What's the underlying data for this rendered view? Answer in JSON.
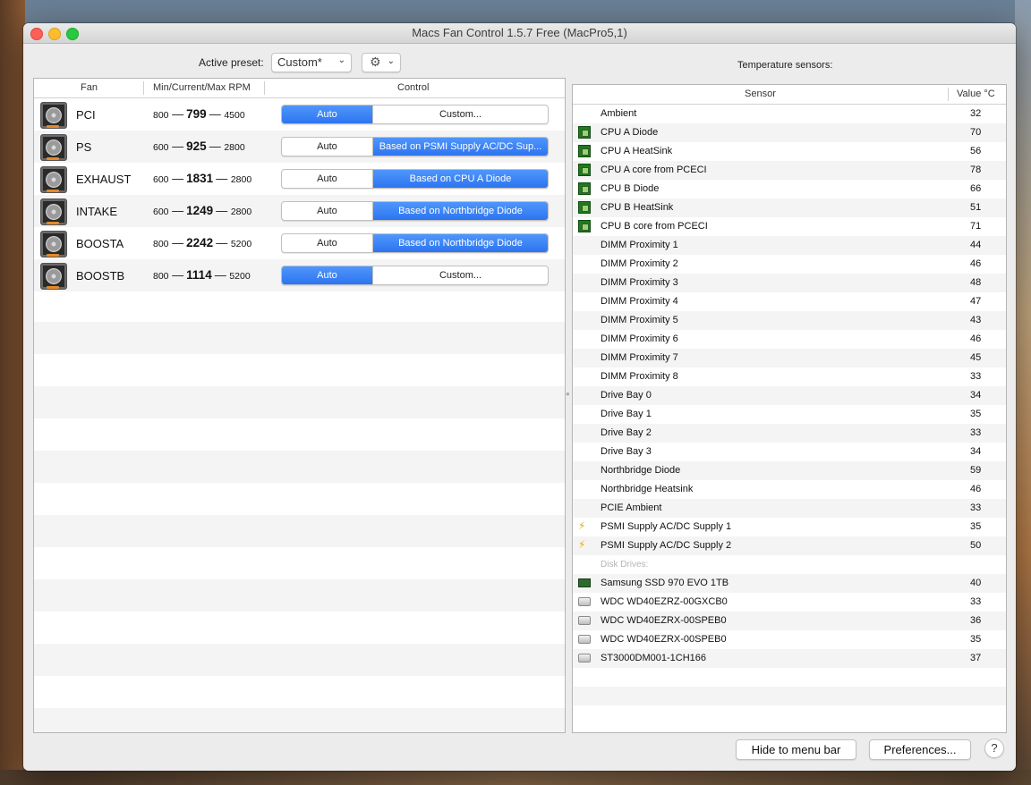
{
  "window": {
    "title": "Macs Fan Control 1.5.7 Free (MacPro5,1)"
  },
  "preset": {
    "label": "Active preset:",
    "value": "Custom*",
    "gear_icon": "gear-icon"
  },
  "fan_table": {
    "headers": {
      "fan": "Fan",
      "rpm": "Min/Current/Max RPM",
      "control": "Control"
    },
    "fans": [
      {
        "name": "PCI",
        "min": "800",
        "current": "799",
        "max": "4500",
        "auto_label": "Auto",
        "mode_label": "Custom...",
        "auto_selected": true
      },
      {
        "name": "PS",
        "min": "600",
        "current": "925",
        "max": "2800",
        "auto_label": "Auto",
        "mode_label": "Based on PSMI Supply AC/DC Sup...",
        "auto_selected": false
      },
      {
        "name": "EXHAUST",
        "min": "600",
        "current": "1831",
        "max": "2800",
        "auto_label": "Auto",
        "mode_label": "Based on CPU A Diode",
        "auto_selected": false
      },
      {
        "name": "INTAKE",
        "min": "600",
        "current": "1249",
        "max": "2800",
        "auto_label": "Auto",
        "mode_label": "Based on Northbridge Diode",
        "auto_selected": false
      },
      {
        "name": "BOOSTA",
        "min": "800",
        "current": "2242",
        "max": "5200",
        "auto_label": "Auto",
        "mode_label": "Based on Northbridge Diode",
        "auto_selected": false
      },
      {
        "name": "BOOSTB",
        "min": "800",
        "current": "1114",
        "max": "5200",
        "auto_label": "Auto",
        "mode_label": "Custom...",
        "auto_selected": true
      }
    ],
    "separator": "—"
  },
  "sensors": {
    "label": "Temperature sensors:",
    "headers": {
      "sensor": "Sensor",
      "value": "Value °C"
    },
    "rows": [
      {
        "name": "Ambient",
        "value": "32",
        "icon": ""
      },
      {
        "name": "CPU A Diode",
        "value": "70",
        "icon": "chip"
      },
      {
        "name": "CPU A HeatSink",
        "value": "56",
        "icon": "chip"
      },
      {
        "name": "CPU A core from PCECI",
        "value": "78",
        "icon": "chip"
      },
      {
        "name": "CPU B Diode",
        "value": "66",
        "icon": "chip"
      },
      {
        "name": "CPU B HeatSink",
        "value": "51",
        "icon": "chip"
      },
      {
        "name": "CPU B core from PCECI",
        "value": "71",
        "icon": "chip"
      },
      {
        "name": "DIMM Proximity 1",
        "value": "44",
        "icon": ""
      },
      {
        "name": "DIMM Proximity 2",
        "value": "46",
        "icon": ""
      },
      {
        "name": "DIMM Proximity 3",
        "value": "48",
        "icon": ""
      },
      {
        "name": "DIMM Proximity 4",
        "value": "47",
        "icon": ""
      },
      {
        "name": "DIMM Proximity 5",
        "value": "43",
        "icon": ""
      },
      {
        "name": "DIMM Proximity 6",
        "value": "46",
        "icon": ""
      },
      {
        "name": "DIMM Proximity 7",
        "value": "45",
        "icon": ""
      },
      {
        "name": "DIMM Proximity 8",
        "value": "33",
        "icon": ""
      },
      {
        "name": "Drive Bay 0",
        "value": "34",
        "icon": ""
      },
      {
        "name": "Drive Bay 1",
        "value": "35",
        "icon": ""
      },
      {
        "name": "Drive Bay 2",
        "value": "33",
        "icon": ""
      },
      {
        "name": "Drive Bay 3",
        "value": "34",
        "icon": ""
      },
      {
        "name": "Northbridge Diode",
        "value": "59",
        "icon": ""
      },
      {
        "name": "Northbridge Heatsink",
        "value": "46",
        "icon": ""
      },
      {
        "name": "PCIE Ambient",
        "value": "33",
        "icon": ""
      },
      {
        "name": "PSMI Supply AC/DC Supply 1",
        "value": "35",
        "icon": "bolt"
      },
      {
        "name": "PSMI Supply AC/DC Supply 2",
        "value": "50",
        "icon": "bolt"
      },
      {
        "name": "Disk Drives:",
        "value": "",
        "icon": "",
        "section": true
      },
      {
        "name": "Samsung SSD 970 EVO 1TB",
        "value": "40",
        "icon": "ssd"
      },
      {
        "name": "WDC WD40EZRZ-00GXCB0",
        "value": "33",
        "icon": "hdd"
      },
      {
        "name": "WDC WD40EZRX-00SPEB0",
        "value": "36",
        "icon": "hdd"
      },
      {
        "name": "WDC WD40EZRX-00SPEB0",
        "value": "35",
        "icon": "hdd"
      },
      {
        "name": "ST3000DM001-1CH166",
        "value": "37",
        "icon": "hdd"
      }
    ]
  },
  "footer": {
    "hide_label": "Hide to menu bar",
    "prefs_label": "Preferences...",
    "help_label": "?"
  },
  "colors": {
    "accent": "#2d74f0",
    "row_alt": "#f4f4f4"
  }
}
